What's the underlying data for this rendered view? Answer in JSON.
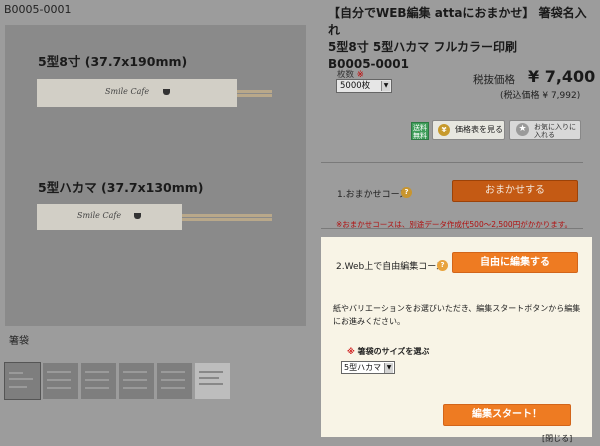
{
  "product": {
    "code": "B0005-0001",
    "title_line1": "【自分でWEB編集 attaにおまかせ】 箸袋名入れ",
    "title_line2": "5型8寸 5型ハカマ フルカラー印刷",
    "title_line3": "B0005-0001"
  },
  "gallery": {
    "size_label_1": "5型8寸 (37.7x190mm)",
    "size_label_2": "5型ハカマ (37.7x130mm)",
    "logo_text": "Smile Cafe",
    "caption": "箸袋",
    "thumbnail_count": 6
  },
  "quantity": {
    "label": "枚数",
    "required_mark": "※",
    "selected": "5000枚"
  },
  "price": {
    "label": "税抜価格",
    "value": "¥ 7,400",
    "tax_included": "(税込価格 ¥ 7,992)"
  },
  "actions": {
    "free_shipping_badge": "送料無料",
    "price_table_button": "価格表を見る",
    "price_table_icon_char": "¥",
    "favorite_button_line1": "お気に入りに",
    "favorite_button_line2": "入れる",
    "favorite_icon_char": "★"
  },
  "course1": {
    "label": "1.おまかせコース",
    "help_char": "?",
    "button": "おまかせする",
    "note": "※おまかせコースは、別途データ作成代500〜2,500円がかかります。"
  },
  "course2": {
    "label": "2.Web上で自由編集コース",
    "help_char": "?",
    "button": "自由に編集する",
    "instructions": "紙やバリエーションをお選びいただき、編集スタートボタンから編集にお進みください。",
    "size_prompt_mark": "※",
    "size_prompt": "箸袋のサイズを選ぶ",
    "size_selected": "5型ハカマ",
    "start_button": "編集スタート！"
  },
  "close_link": "[閉じる]",
  "colors": {
    "overlay_gray": "#9c9c9c",
    "panel_cream": "#f8f4e6",
    "orange_dark": "#c45a14",
    "orange_bright": "#ee7b22",
    "note_red": "#b01010",
    "badge_green": "#3f9d5a"
  }
}
